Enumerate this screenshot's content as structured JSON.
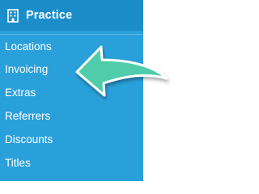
{
  "sidebar": {
    "header": {
      "icon": "building-icon",
      "title": "Practice"
    },
    "items": [
      {
        "label": "Locations"
      },
      {
        "label": "Invoicing"
      },
      {
        "label": "Extras"
      },
      {
        "label": "Referrers"
      },
      {
        "label": "Discounts"
      },
      {
        "label": "Titles"
      }
    ]
  },
  "annotation": {
    "icon": "arrow-left-icon",
    "color": "#4fcdaa"
  },
  "colors": {
    "sidebar_bg": "#2aa0da",
    "header_bg": "#1b8ec9",
    "text": "#ffffff"
  }
}
